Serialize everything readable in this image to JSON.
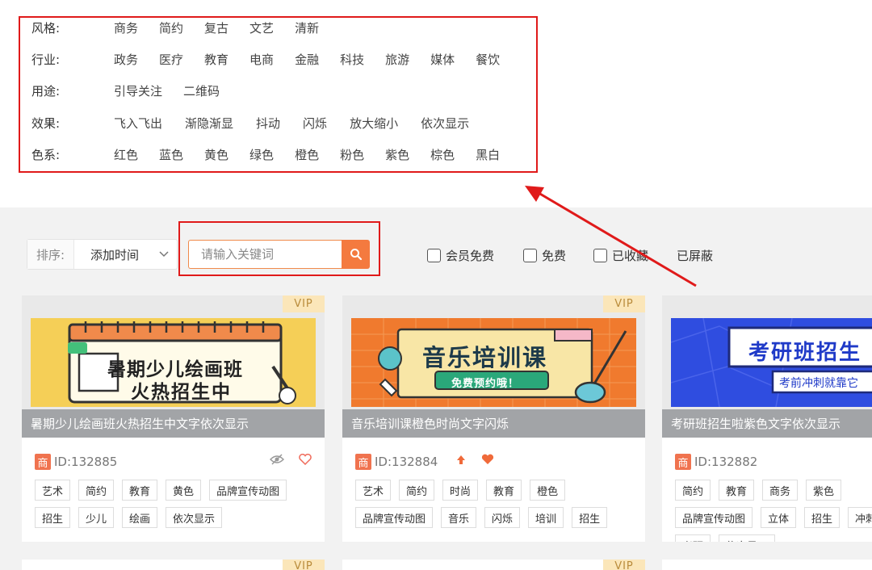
{
  "filters": [
    {
      "label": "风格:",
      "options": [
        "商务",
        "简约",
        "复古",
        "文艺",
        "清新"
      ]
    },
    {
      "label": "行业:",
      "options": [
        "政务",
        "医疗",
        "教育",
        "电商",
        "金融",
        "科技",
        "旅游",
        "媒体",
        "餐饮"
      ]
    },
    {
      "label": "用途:",
      "options": [
        "引导关注",
        "二维码"
      ]
    },
    {
      "label": "效果:",
      "options": [
        "飞入飞出",
        "渐隐渐显",
        "抖动",
        "闪烁",
        "放大缩小",
        "依次显示"
      ]
    },
    {
      "label": "色系:",
      "options": [
        "红色",
        "蓝色",
        "黄色",
        "绿色",
        "橙色",
        "粉色",
        "紫色",
        "棕色",
        "黑白"
      ]
    }
  ],
  "toolbar": {
    "sort_label": "排序:",
    "sort_value": "添加时间",
    "search_placeholder": "请输入关键词",
    "checks": [
      "会员免费",
      "免费",
      "已收藏"
    ],
    "blocked_label": "已屏蔽"
  },
  "cards": [
    {
      "vip": "VIP",
      "img_line1": "暑期少儿绘画班",
      "img_line2": "火热招生中",
      "title": "暑期少儿绘画班火热招生中文字依次显示",
      "badge": "商",
      "id": "ID:132885",
      "tags": [
        "艺术",
        "简约",
        "教育",
        "黄色",
        "品牌宣传动图",
        "招生",
        "少儿",
        "绘画",
        "依次显示"
      ]
    },
    {
      "vip": "VIP",
      "img_line1": "音乐培训课",
      "img_line2": "免费预约哦！",
      "title": "音乐培训课橙色时尚文字闪烁",
      "badge": "商",
      "id": "ID:132884",
      "tags": [
        "艺术",
        "简约",
        "时尚",
        "教育",
        "橙色",
        "品牌宣传动图",
        "音乐",
        "闪烁",
        "培训",
        "招生"
      ]
    },
    {
      "vip": "",
      "img_line1": "考研班招生",
      "img_line2": "考前冲刺就靠它",
      "title": "考研班招生啦紫色文字依次显示",
      "badge": "商",
      "id": "ID:132882",
      "tags": [
        "简约",
        "教育",
        "商务",
        "紫色",
        "品牌宣传动图",
        "立体",
        "招生",
        "冲刺",
        "考研",
        "依次显示"
      ]
    }
  ],
  "bottom_vip": "VIP",
  "colors": {
    "accent": "#f47a3f",
    "highlight": "#e01a1a",
    "vip_bg": "#fbe6b9"
  }
}
